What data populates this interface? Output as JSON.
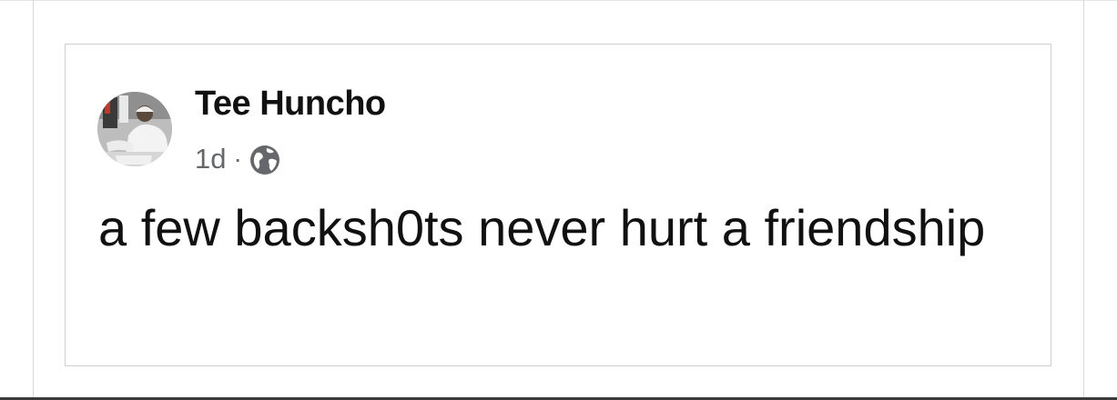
{
  "post": {
    "author": "Tee Huncho",
    "timestamp": "1d",
    "separator": "·",
    "audience_icon": "globe-icon",
    "text": "a few backsh0ts never hurt a friendship"
  },
  "colors": {
    "name_text": "#111111",
    "meta_text": "#65676b",
    "border": "#cfcfcf"
  }
}
